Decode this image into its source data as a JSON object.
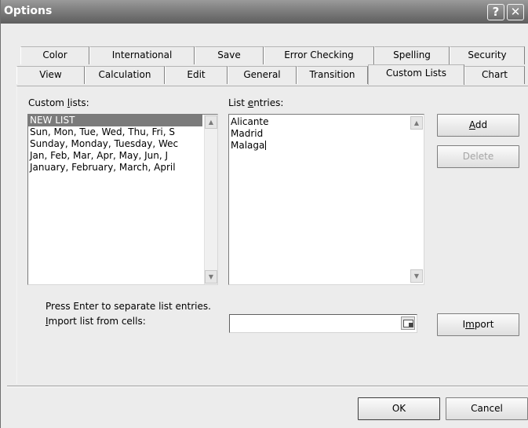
{
  "window": {
    "title": "Options",
    "help_label": "?",
    "close_label": "✕"
  },
  "tabs_row1": [
    {
      "label": "Color"
    },
    {
      "label": "International"
    },
    {
      "label": "Save"
    },
    {
      "label": "Error Checking"
    },
    {
      "label": "Spelling"
    },
    {
      "label": "Security"
    }
  ],
  "tabs_row2": [
    {
      "label": "View"
    },
    {
      "label": "Calculation"
    },
    {
      "label": "Edit"
    },
    {
      "label": "General"
    },
    {
      "label": "Transition"
    },
    {
      "label": "Custom Lists",
      "active": true
    },
    {
      "label": "Chart"
    }
  ],
  "custom_lists": {
    "label_pre": "Custom ",
    "label_ul": "l",
    "label_post": "ists:",
    "items": [
      "NEW LIST",
      "Sun, Mon, Tue, Wed, Thu, Fri, S",
      "Sunday, Monday, Tuesday, Wec",
      "Jan, Feb, Mar, Apr, May, Jun, J",
      "January, February, March, April"
    ],
    "selected_index": 0
  },
  "list_entries": {
    "label_pre": "List ",
    "label_ul": "e",
    "label_post": "ntries:",
    "lines": [
      "Alicante",
      "Madrid",
      "Malaga"
    ]
  },
  "buttons": {
    "add_ul": "A",
    "add_rest": "dd",
    "delete": "Delete",
    "import_pre": "I",
    "import_ul": "m",
    "import_post": "port",
    "ok": "OK",
    "cancel": "Cancel"
  },
  "hint": "Press Enter to separate list entries.",
  "import": {
    "label_ul": "I",
    "label_rest": "mport list from cells:",
    "value": ""
  },
  "icons": {
    "scroll_up": "scroll-up-arrow-icon",
    "scroll_down": "scroll-down-arrow-icon",
    "collapse_dialog": "collapse-dialog-icon"
  }
}
